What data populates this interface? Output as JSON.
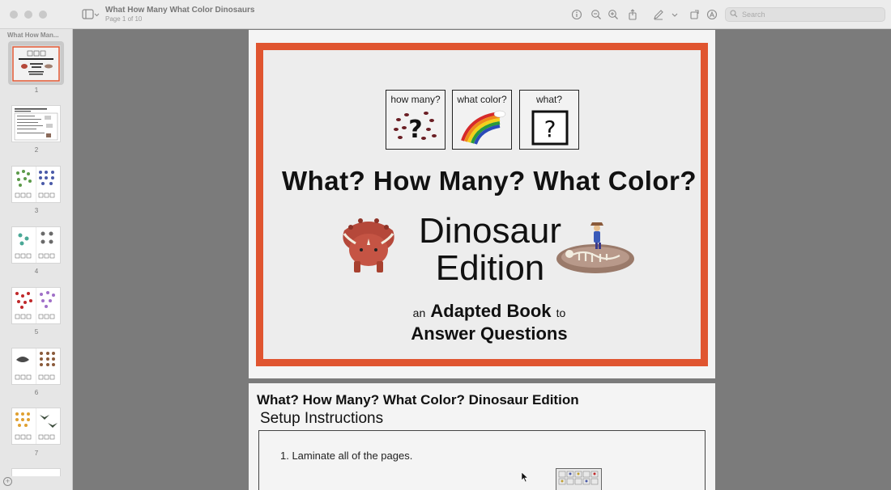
{
  "window": {
    "title": "What How Many What Color Dinosaurs",
    "subtitle": "Page 1 of 10"
  },
  "toolbar": {
    "search_placeholder": "Search",
    "icons": [
      "sidebar-toggle-icon",
      "info-icon",
      "zoom-out-icon",
      "zoom-in-icon",
      "share-icon",
      "markup-pen-icon",
      "chevron-down-icon",
      "rotate-icon",
      "annotate-icon",
      "search-icon"
    ]
  },
  "sidebar": {
    "title": "What How Man...",
    "thumbnails": [
      {
        "label": "1"
      },
      {
        "label": "2"
      },
      {
        "label": "3"
      },
      {
        "label": "4"
      },
      {
        "label": "5"
      },
      {
        "label": "6"
      },
      {
        "label": "7"
      }
    ]
  },
  "page1": {
    "questions": [
      "how many?",
      "what color?",
      "what?"
    ],
    "title": "What? How Many? What Color?",
    "edition_line1": "Dinosaur",
    "edition_line2": "Edition",
    "adapted_prefix": "an",
    "adapted_bold": "Adapted Book",
    "adapted_suffix": "to",
    "adapted_line2": "Answer Questions",
    "question_mark": "?"
  },
  "page2": {
    "title": "What? How Many? What Color? Dinosaur Edition",
    "subtitle": "Setup Instructions",
    "step1": "1. Laminate all of the pages."
  },
  "colors": {
    "frame_accent": "#e05530",
    "dino_red": "#b5483a"
  }
}
